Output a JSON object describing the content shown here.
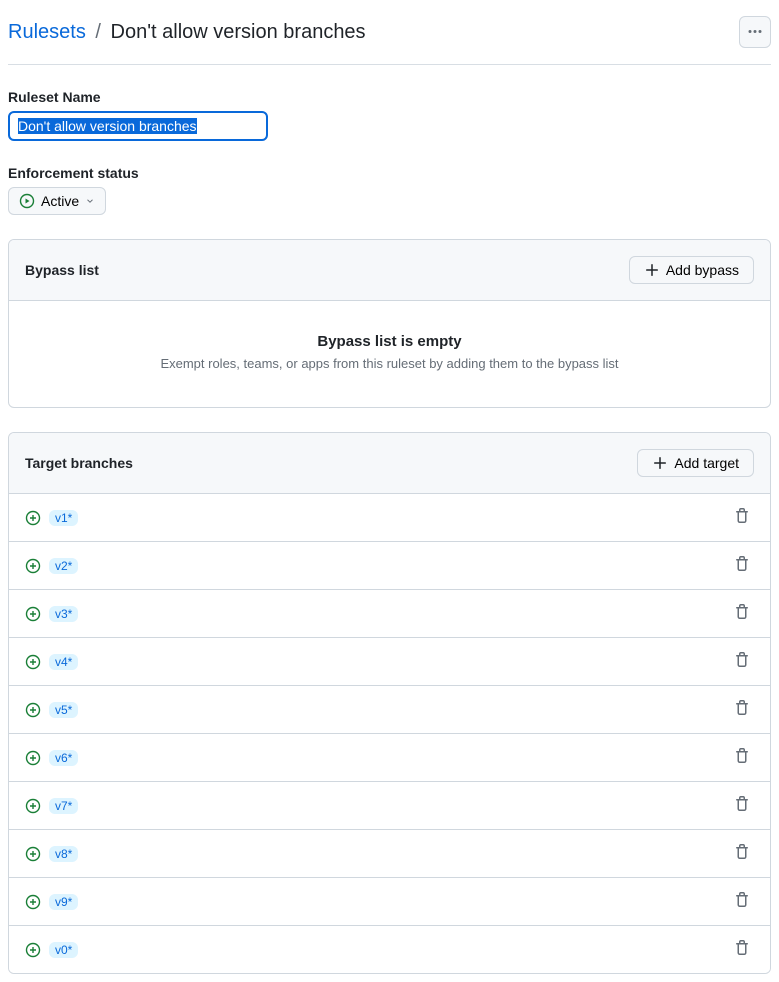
{
  "breadcrumb": {
    "root": "Rulesets",
    "separator": "/",
    "current": "Don't allow version branches"
  },
  "ruleset_name": {
    "label": "Ruleset Name",
    "value": "Don't allow version branches"
  },
  "enforcement": {
    "label": "Enforcement status",
    "status": "Active"
  },
  "bypass": {
    "title": "Bypass list",
    "add_label": "Add bypass",
    "empty_title": "Bypass list is empty",
    "empty_desc": "Exempt roles, teams, or apps from this ruleset by adding them to the bypass list"
  },
  "targets": {
    "title": "Target branches",
    "add_label": "Add target",
    "items": [
      {
        "pattern": "v1*"
      },
      {
        "pattern": "v2*"
      },
      {
        "pattern": "v3*"
      },
      {
        "pattern": "v4*"
      },
      {
        "pattern": "v5*"
      },
      {
        "pattern": "v6*"
      },
      {
        "pattern": "v7*"
      },
      {
        "pattern": "v8*"
      },
      {
        "pattern": "v9*"
      },
      {
        "pattern": "v0*"
      }
    ]
  }
}
